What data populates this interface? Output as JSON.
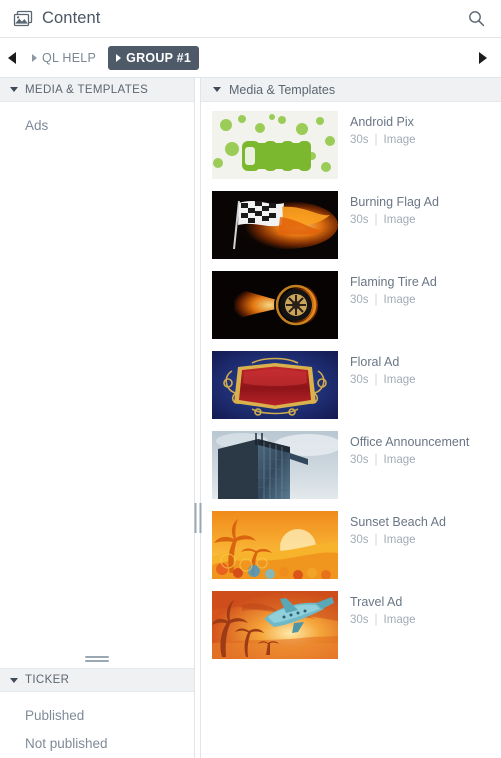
{
  "header": {
    "icon": "image-content-icon",
    "title": "Content",
    "search_icon": "search-icon"
  },
  "breadcrumb": {
    "prev_icon": "arrow-left-icon",
    "next_icon": "arrow-right-icon",
    "items": [
      {
        "label": "QL HELP",
        "active": false
      },
      {
        "label": "GROUP #1",
        "active": true
      }
    ]
  },
  "sidebar": {
    "sections": [
      {
        "name": "media-templates-section",
        "label": "MEDIA & TEMPLATES",
        "items": [
          {
            "label": "Ads"
          }
        ]
      },
      {
        "name": "ticker-section",
        "label": "TICKER",
        "items": [
          {
            "label": "Published"
          },
          {
            "label": "Not published"
          }
        ]
      }
    ]
  },
  "content_panel": {
    "header_label": "Media & Templates",
    "items": [
      {
        "name": "Android Pix",
        "duration": "30s",
        "separator": "|",
        "type": "Image",
        "thumb": "android-pix"
      },
      {
        "name": "Burning Flag Ad",
        "duration": "30s",
        "separator": "|",
        "type": "Image",
        "thumb": "burning-flag"
      },
      {
        "name": "Flaming Tire Ad",
        "duration": "30s",
        "separator": "|",
        "type": "Image",
        "thumb": "flaming-tire"
      },
      {
        "name": "Floral Ad",
        "duration": "30s",
        "separator": "|",
        "type": "Image",
        "thumb": "floral"
      },
      {
        "name": "Office Announcement",
        "duration": "30s",
        "separator": "|",
        "type": "Image",
        "thumb": "office"
      },
      {
        "name": "Sunset Beach Ad",
        "duration": "30s",
        "separator": "|",
        "type": "Image",
        "thumb": "sunset-beach"
      },
      {
        "name": "Travel Ad",
        "duration": "30s",
        "separator": "|",
        "type": "Image",
        "thumb": "travel"
      }
    ]
  },
  "colors": {
    "accent_active": "#4e5a68",
    "panel_header_bg": "#f0f1f2",
    "text_muted": "#7f8b98",
    "border": "#e2e5e8"
  }
}
